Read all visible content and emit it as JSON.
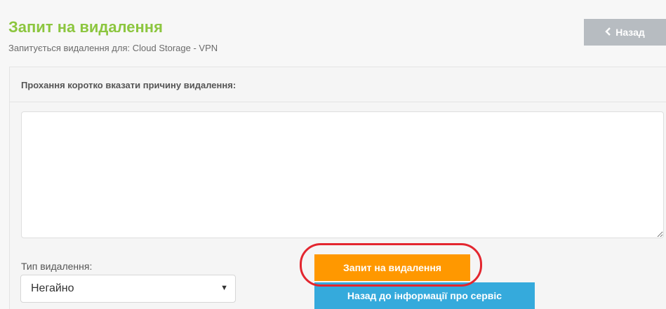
{
  "header": {
    "title": "Запит на видалення",
    "subtitle": "Запитується видалення для: Cloud Storage - VPN",
    "back_label": "Назад",
    "back_icon": "chevron-left-icon"
  },
  "form": {
    "reason_label": "Прохання коротко вказати причину видалення:",
    "reason_value": "",
    "type_label": "Тип видалення:",
    "type_selected": "Негайно",
    "submit_label": "Запит на видалення",
    "back_to_service_label": "Назад до інформації про сервіс"
  },
  "colors": {
    "title": "#8cc63f",
    "back_button": "#b7bcc1",
    "submit_button": "#ff9800",
    "service_button": "#35aadc",
    "highlight": "#e3262f"
  }
}
